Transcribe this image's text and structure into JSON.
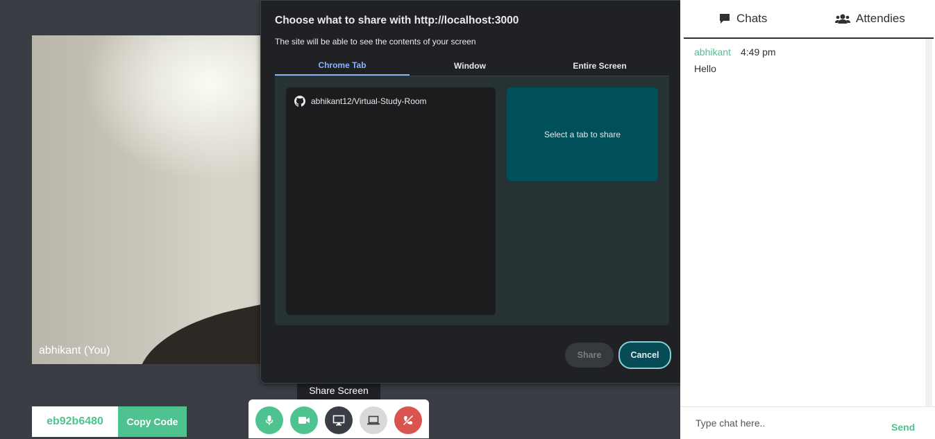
{
  "video": {
    "participant_name": "abhikant (You)"
  },
  "room": {
    "code": "eb92b6480",
    "copy_label": "Copy Code"
  },
  "tooltip": {
    "text": "Share Screen"
  },
  "controls": [
    {
      "icon": "microphone-icon",
      "color": "#4fc38f"
    },
    {
      "icon": "video-camera-icon",
      "color": "#4fc38f"
    },
    {
      "icon": "monitor-icon",
      "color": "#3b3d45"
    },
    {
      "icon": "laptop-icon",
      "color": "#d9d9d9"
    },
    {
      "icon": "phone-hangup-icon",
      "color": "#d9534f"
    }
  ],
  "dialog": {
    "title": "Choose what to share with http://localhost:3000",
    "subtitle": "The site will be able to see the contents of your screen",
    "tabs": [
      {
        "label": "Chrome Tab",
        "active": true
      },
      {
        "label": "Window",
        "active": false
      },
      {
        "label": "Entire Screen",
        "active": false
      }
    ],
    "tab_items": [
      {
        "label": "abhikant12/Virtual-Study-Room",
        "icon": "github-icon"
      }
    ],
    "preview_text": "Select a tab to share",
    "share_label": "Share",
    "cancel_label": "Cancel"
  },
  "sidebar": {
    "tabs": [
      {
        "label": "Chats",
        "icon": "chat-bubble-icon"
      },
      {
        "label": "Attendies",
        "icon": "users-icon"
      }
    ],
    "messages": [
      {
        "author": "abhikant",
        "time": "4:49 pm",
        "text": "Hello"
      }
    ],
    "input_placeholder": "Type chat here..",
    "send_label": "Send"
  },
  "colors": {
    "accent": "#4fc38f",
    "danger": "#d9534f",
    "dialog_bg": "#202124",
    "active_tab": "#8ab4f8",
    "preview_bg": "#00505a"
  }
}
